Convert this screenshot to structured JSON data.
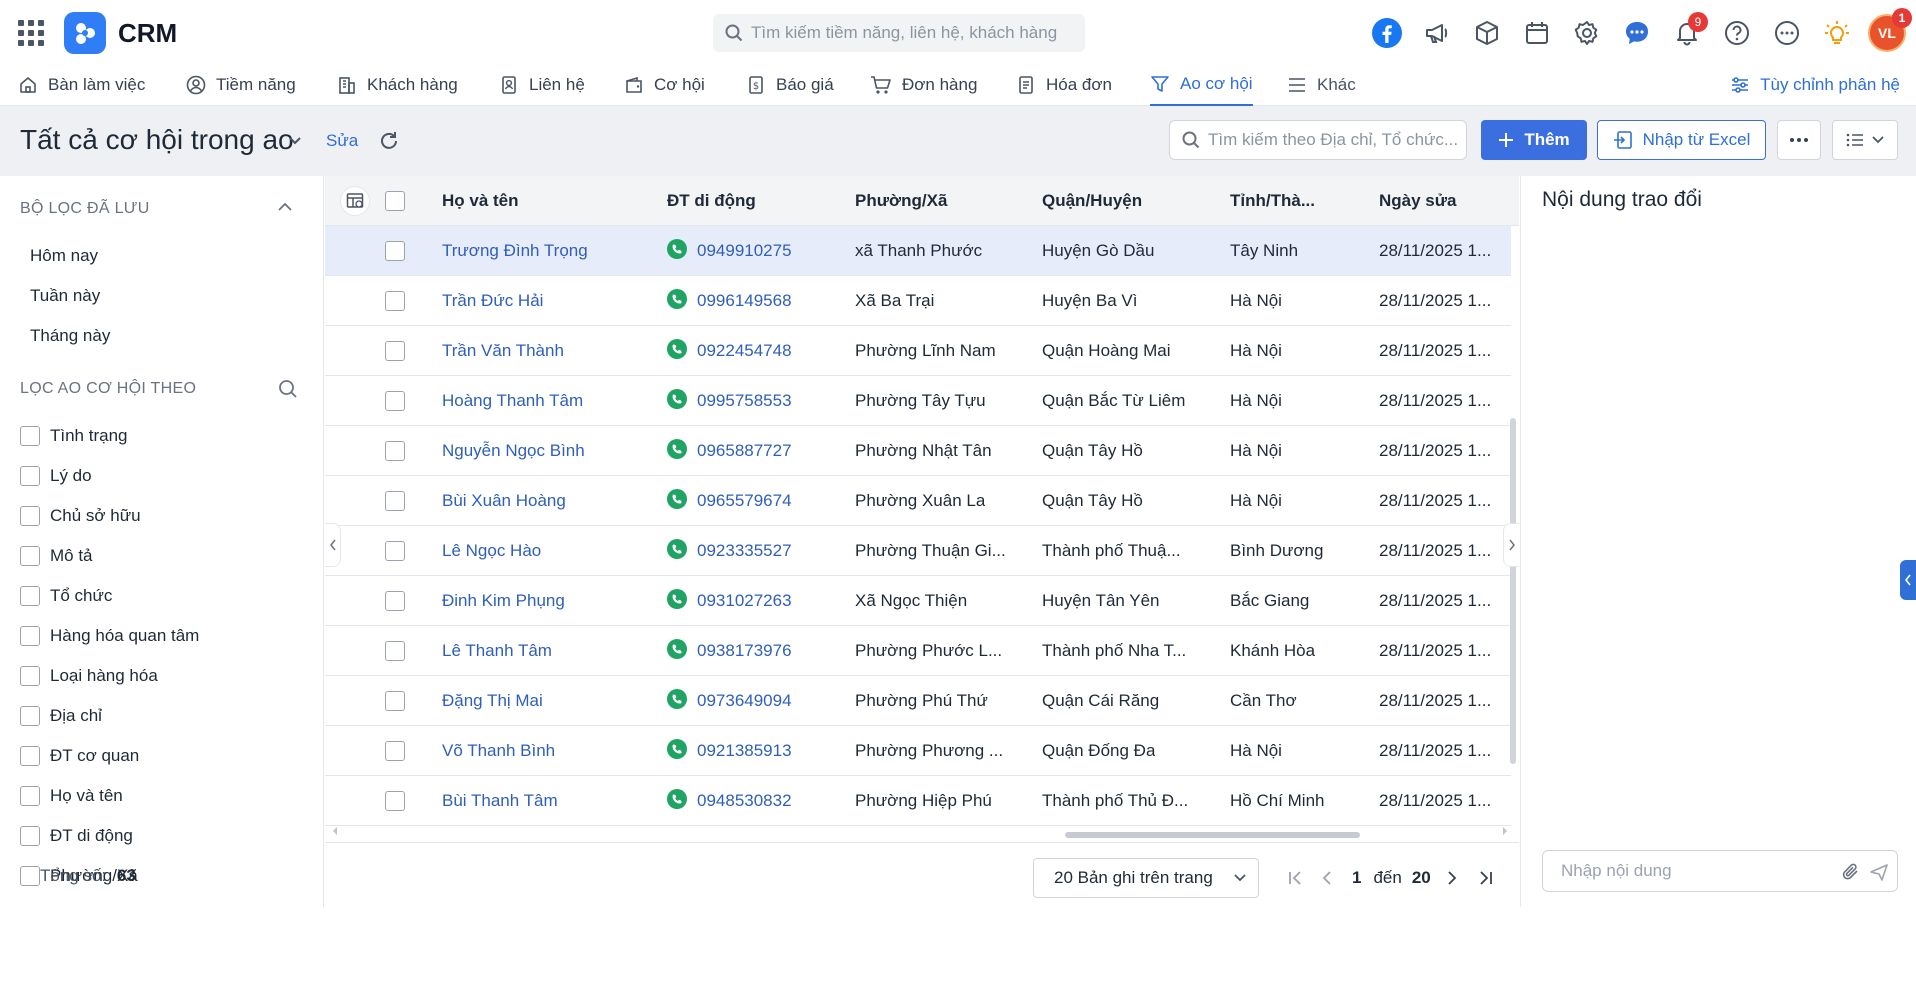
{
  "app": {
    "name": "CRM"
  },
  "global_search": {
    "placeholder": "Tìm kiếm tiềm năng, liên hệ, khách hàng"
  },
  "top_icons": {
    "notifications_badge": "9",
    "avatar_initials": "VL",
    "avatar_badge": "1"
  },
  "nav": {
    "items": [
      {
        "label": "Bàn làm việc",
        "icon": "desk-icon"
      },
      {
        "label": "Tiềm năng",
        "icon": "user-circle-icon"
      },
      {
        "label": "Khách hàng",
        "icon": "building-icon"
      },
      {
        "label": "Liên hệ",
        "icon": "contact-icon"
      },
      {
        "label": "Cơ hội",
        "icon": "wallet-icon"
      },
      {
        "label": "Báo giá",
        "icon": "quote-icon"
      },
      {
        "label": "Đơn hàng",
        "icon": "cart-icon"
      },
      {
        "label": "Hóa đơn",
        "icon": "invoice-icon"
      },
      {
        "label": "Ao cơ hội",
        "icon": "funnel-icon",
        "active": true
      },
      {
        "label": "Khác",
        "icon": "menu-icon"
      }
    ],
    "customize_label": "Tùy chỉnh phân hệ"
  },
  "page": {
    "title": "Tất cả cơ hội trong ao",
    "edit_label": "Sửa",
    "search_placeholder": "Tìm kiếm theo Địa chỉ, Tổ chức...",
    "add_label": "Thêm",
    "import_label": "Nhập từ Excel"
  },
  "sidebar": {
    "saved_title": "BỘ LỌC ĐÃ LƯU",
    "saved_items": [
      "Hôm nay",
      "Tuần này",
      "Tháng này"
    ],
    "filter_title": "LỌC AO CƠ HỘI THEO",
    "filters": [
      "Tình trạng",
      "Lý do",
      "Chủ sở hữu",
      "Mô tả",
      "Tổ chức",
      "Hàng hóa quan tâm",
      "Loại hàng hóa",
      "Địa chỉ",
      "ĐT cơ quan",
      "Họ và tên",
      "ĐT di động",
      "Phường/Xã"
    ]
  },
  "table": {
    "columns": {
      "name": "Họ và tên",
      "mobile": "ĐT di động",
      "ward": "Phường/Xã",
      "district": "Quận/Huyện",
      "province": "Tỉnh/Thà...",
      "modified": "Ngày sửa"
    },
    "rows": [
      {
        "name": "Trương Đình Trọng",
        "mobile": "0949910275",
        "ward": "xã Thanh Phước",
        "district": "Huyện Gò Dầu",
        "province": "Tây Ninh",
        "modified": "28/11/2025 1...",
        "selected": true
      },
      {
        "name": "Trần Đức Hải",
        "mobile": "0996149568",
        "ward": "Xã Ba Trại",
        "district": "Huyện Ba Vì",
        "province": "Hà Nội",
        "modified": "28/11/2025 1..."
      },
      {
        "name": "Trần Văn Thành",
        "mobile": "0922454748",
        "ward": "Phường Lĩnh Nam",
        "district": "Quận Hoàng Mai",
        "province": "Hà Nội",
        "modified": "28/11/2025 1..."
      },
      {
        "name": "Hoàng Thanh Tâm",
        "mobile": "0995758553",
        "ward": "Phường Tây Tựu",
        "district": "Quận Bắc Từ Liêm",
        "province": "Hà Nội",
        "modified": "28/11/2025 1..."
      },
      {
        "name": "Nguyễn Ngọc Bình",
        "mobile": "0965887727",
        "ward": "Phường Nhật Tân",
        "district": "Quận Tây Hồ",
        "province": "Hà Nội",
        "modified": "28/11/2025 1..."
      },
      {
        "name": "Bùi Xuân Hoàng",
        "mobile": "0965579674",
        "ward": "Phường Xuân La",
        "district": "Quận Tây Hồ",
        "province": "Hà Nội",
        "modified": "28/11/2025 1..."
      },
      {
        "name": "Lê Ngọc Hào",
        "mobile": "0923335527",
        "ward": "Phường Thuận Gi...",
        "district": "Thành phố Thuậ...",
        "province": "Bình Dương",
        "modified": "28/11/2025 1..."
      },
      {
        "name": "Đinh Kim Phụng",
        "mobile": "0931027263",
        "ward": "Xã Ngọc Thiện",
        "district": "Huyện Tân Yên",
        "province": "Bắc Giang",
        "modified": "28/11/2025 1..."
      },
      {
        "name": "Lê Thanh Tâm",
        "mobile": "0938173976",
        "ward": "Phường Phước L...",
        "district": "Thành phố Nha T...",
        "province": "Khánh Hòa",
        "modified": "28/11/2025 1..."
      },
      {
        "name": "Đặng Thị Mai",
        "mobile": "0973649094",
        "ward": "Phường Phú Thứ",
        "district": "Quận Cái Răng",
        "province": "Cần Thơ",
        "modified": "28/11/2025 1..."
      },
      {
        "name": "Võ Thanh Bình",
        "mobile": "0921385913",
        "ward": "Phường Phương ...",
        "district": "Quận Đống Đa",
        "province": "Hà Nội",
        "modified": "28/11/2025 1..."
      },
      {
        "name": "Bùi Thanh Tâm",
        "mobile": "0948530832",
        "ward": "Phường Hiệp Phú",
        "district": "Thành phố Thủ Đ...",
        "province": "Hồ Chí Minh",
        "modified": "28/11/2025 1..."
      }
    ]
  },
  "footer": {
    "total_label": "Tổng số:",
    "total_value": "63",
    "page_size": "20 Bản ghi trên trang",
    "page_from": "1",
    "to_label": "đến",
    "page_to": "20"
  },
  "panel": {
    "title": "Nội dung trao đổi",
    "comment_placeholder": "Nhập nội dung"
  },
  "colors": {
    "accent": "#2f6fd6",
    "primary_button": "#3b6fe0",
    "selected_row": "#e7ecfb",
    "phone_green": "#1fa463",
    "badge_red": "#e53935"
  }
}
